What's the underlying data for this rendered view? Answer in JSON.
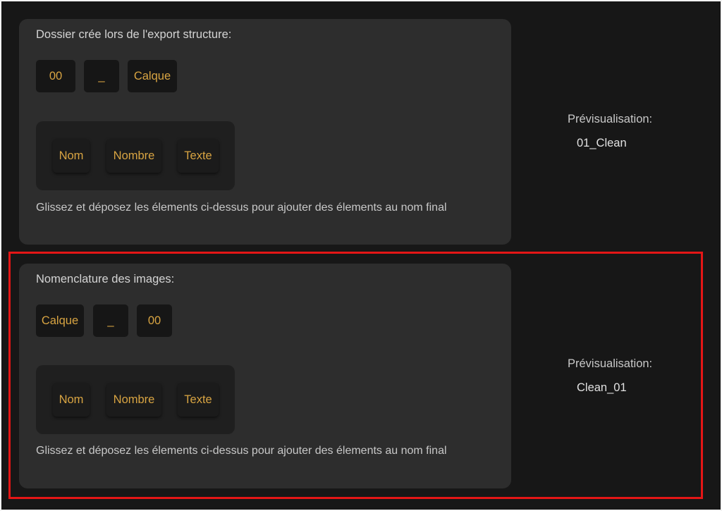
{
  "folder_section": {
    "title": "Dossier crée lors de l'export structure:",
    "sequence": [
      "00",
      "_",
      "Calque"
    ],
    "palette": [
      "Nom",
      "Nombre",
      "Texte"
    ],
    "hint": "Glissez et déposez les élements ci-dessus pour ajouter des élements au nom final",
    "preview_label": "Prévisualisation:",
    "preview_value": "01_Clean"
  },
  "image_section": {
    "title": "Nomenclature des images:",
    "sequence": [
      "Calque",
      "_",
      "00"
    ],
    "palette": [
      "Nom",
      "Nombre",
      "Texte"
    ],
    "hint": "Glissez et déposez les élements ci-dessus pour ajouter des élements au nom final",
    "preview_label": "Prévisualisation:",
    "preview_value": "Clean_01"
  },
  "colors": {
    "background": "#171717",
    "panel": "#2d2d2d",
    "token_text": "#d8a442",
    "highlight": "#e41616"
  }
}
